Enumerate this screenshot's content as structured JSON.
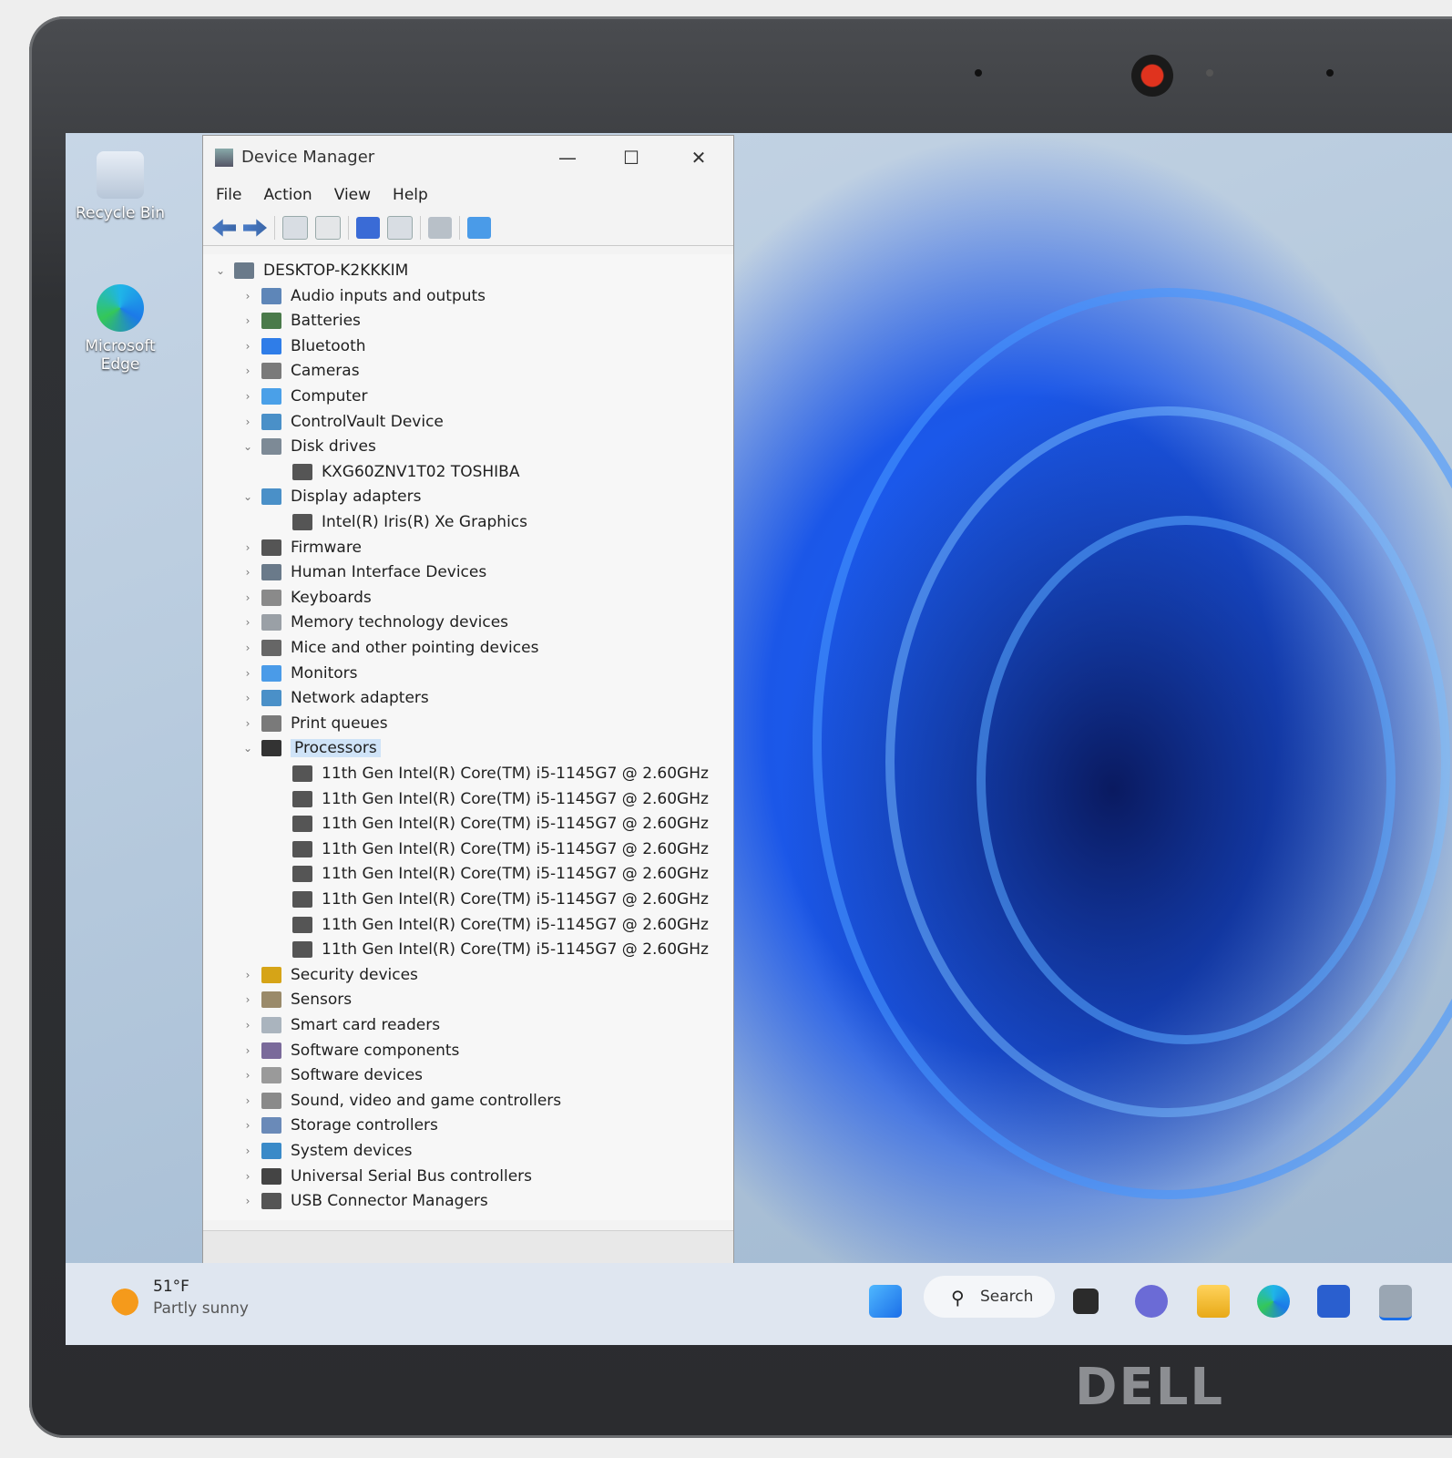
{
  "desktop": {
    "icons": [
      {
        "label": "Recycle Bin"
      },
      {
        "label": "Microsoft Edge"
      }
    ]
  },
  "window": {
    "title": "Device Manager",
    "controls": {
      "minimize": "—",
      "maximize": "☐",
      "close": "✕"
    },
    "menu": [
      "File",
      "Action",
      "View",
      "Help"
    ]
  },
  "tree": {
    "root": "DESKTOP-K2KKKIM",
    "items": [
      {
        "label": "Audio inputs and outputs",
        "expanded": false
      },
      {
        "label": "Batteries",
        "expanded": false
      },
      {
        "label": "Bluetooth",
        "expanded": false
      },
      {
        "label": "Cameras",
        "expanded": false
      },
      {
        "label": "Computer",
        "expanded": false
      },
      {
        "label": "ControlVault Device",
        "expanded": false
      },
      {
        "label": "Disk drives",
        "expanded": true,
        "children": [
          "KXG60ZNV1T02 TOSHIBA"
        ]
      },
      {
        "label": "Display adapters",
        "expanded": true,
        "children": [
          "Intel(R) Iris(R) Xe Graphics"
        ]
      },
      {
        "label": "Firmware",
        "expanded": false
      },
      {
        "label": "Human Interface Devices",
        "expanded": false
      },
      {
        "label": "Keyboards",
        "expanded": false
      },
      {
        "label": "Memory technology devices",
        "expanded": false
      },
      {
        "label": "Mice and other pointing devices",
        "expanded": false
      },
      {
        "label": "Monitors",
        "expanded": false
      },
      {
        "label": "Network adapters",
        "expanded": false
      },
      {
        "label": "Print queues",
        "expanded": false
      },
      {
        "label": "Processors",
        "expanded": true,
        "selected": true,
        "children": [
          "11th Gen Intel(R) Core(TM) i5-1145G7 @ 2.60GHz",
          "11th Gen Intel(R) Core(TM) i5-1145G7 @ 2.60GHz",
          "11th Gen Intel(R) Core(TM) i5-1145G7 @ 2.60GHz",
          "11th Gen Intel(R) Core(TM) i5-1145G7 @ 2.60GHz",
          "11th Gen Intel(R) Core(TM) i5-1145G7 @ 2.60GHz",
          "11th Gen Intel(R) Core(TM) i5-1145G7 @ 2.60GHz",
          "11th Gen Intel(R) Core(TM) i5-1145G7 @ 2.60GHz",
          "11th Gen Intel(R) Core(TM) i5-1145G7 @ 2.60GHz"
        ]
      },
      {
        "label": "Security devices",
        "expanded": false
      },
      {
        "label": "Sensors",
        "expanded": false
      },
      {
        "label": "Smart card readers",
        "expanded": false
      },
      {
        "label": "Software components",
        "expanded": false
      },
      {
        "label": "Software devices",
        "expanded": false
      },
      {
        "label": "Sound, video and game controllers",
        "expanded": false
      },
      {
        "label": "Storage controllers",
        "expanded": false
      },
      {
        "label": "System devices",
        "expanded": false
      },
      {
        "label": "Universal Serial Bus controllers",
        "expanded": false
      },
      {
        "label": "USB Connector Managers",
        "expanded": false
      }
    ]
  },
  "taskbar": {
    "weather_temp": "51°F",
    "weather_desc": "Partly sunny",
    "search_label": "Search"
  },
  "brand": "DELL",
  "colors": {
    "accent": "#1a6ee8",
    "selection": "#cfe3f7",
    "camera_led": "#e0331e"
  }
}
